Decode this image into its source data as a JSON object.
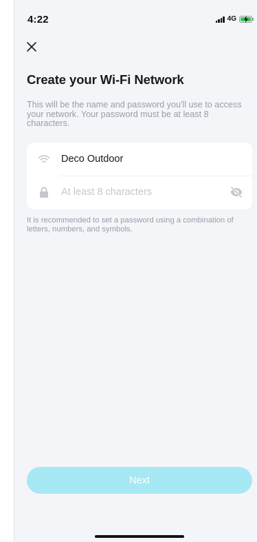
{
  "status_bar": {
    "time": "4:22",
    "network": "4G",
    "battery_color": "#35c759"
  },
  "header": {
    "close_icon": "close-x-icon",
    "title": "Create your Wi-Fi Network",
    "description": "This will be the name and password you'll use to access your network. Your password must be at least 8 characters."
  },
  "form": {
    "network_name": {
      "icon": "wifi-icon",
      "value": "Deco Outdoor",
      "placeholder": ""
    },
    "password": {
      "icon": "lock-icon",
      "value": "",
      "placeholder": "At least 8 characters",
      "visibility_icon": "eye-off-icon"
    }
  },
  "hint": "It is recommended to set a password using a combination of letters, numbers, and symbols.",
  "footer": {
    "next_label": "Next",
    "next_color": "#a6e8f3"
  }
}
